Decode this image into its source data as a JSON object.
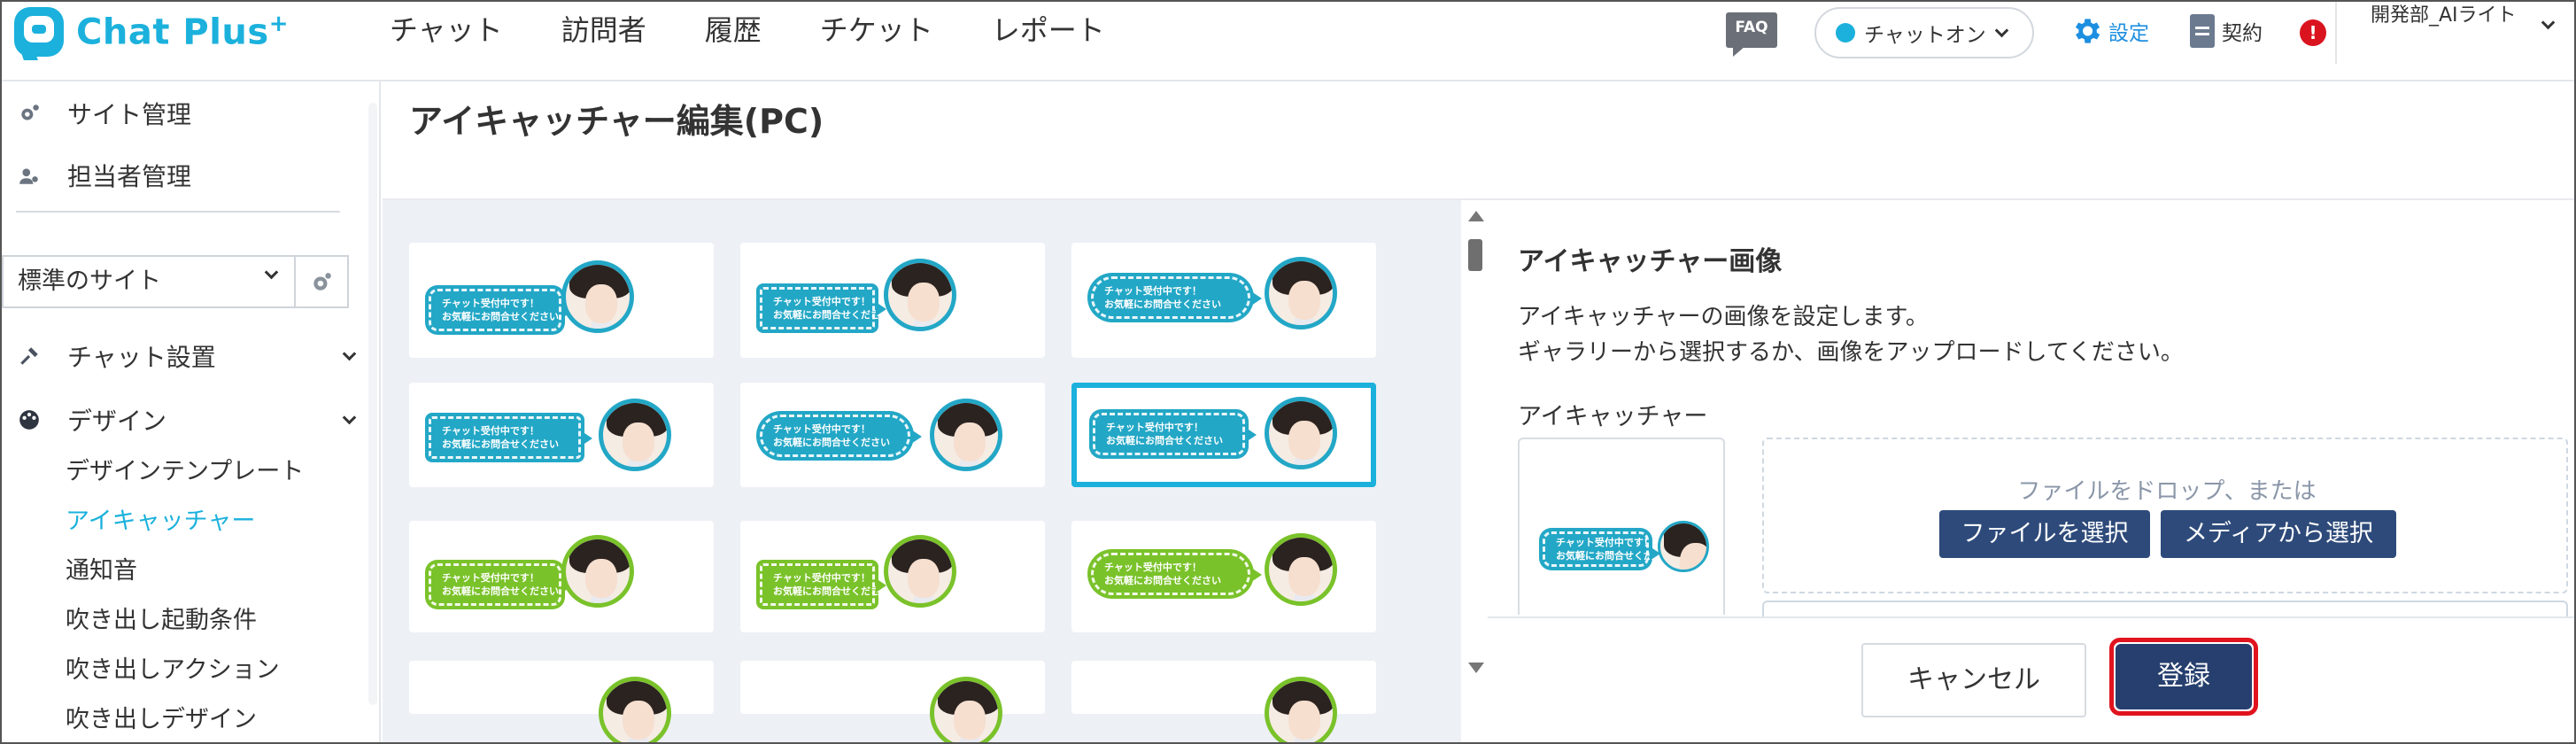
{
  "header": {
    "logo_text": "Chat Plus",
    "logo_plus": "+",
    "nav": [
      "チャット",
      "訪問者",
      "履歴",
      "チケット",
      "レポート"
    ],
    "faq_label": "FAQ",
    "chat_status": "チャットオン",
    "settings_label": "設定",
    "contract_label": "契約",
    "alert_mark": "!",
    "account_name": "開発部_AIライト"
  },
  "sidebar": {
    "site_manage": "サイト管理",
    "staff_manage": "担当者管理",
    "site_select_value": "標準のサイト",
    "chat_setup": "チャット設置",
    "design": "デザイン",
    "sub_items": [
      "デザインテンプレート",
      "アイキャッチャー",
      "通知音",
      "吹き出し起動条件",
      "吹き出しアクション",
      "吹き出しデザイン"
    ],
    "active_sub_index": 1
  },
  "main": {
    "page_title": "アイキャッチャー編集(PC)",
    "bubble_line1": "チャット受付中です！",
    "bubble_line2": "お気軽にお問合せください",
    "panel": {
      "title": "アイキャッチャー画像",
      "desc_line1": "アイキャッチャーの画像を設定します。",
      "desc_line2": "ギャラリーから選択するか、画像をアップロードしてください。",
      "field_label": "アイキャッチャー",
      "drop_text": "ファイルをドロップ、または",
      "select_file": "ファイルを選択",
      "select_media": "メディアから選択"
    },
    "cancel_label": "キャンセル",
    "submit_label": "登録"
  },
  "colors": {
    "brand": "#1bb1dc",
    "tile_blue": "#23a7c6",
    "tile_green": "#7ac22a",
    "button_dark": "#2d4a7a",
    "submit_outline": "#e0141e"
  }
}
